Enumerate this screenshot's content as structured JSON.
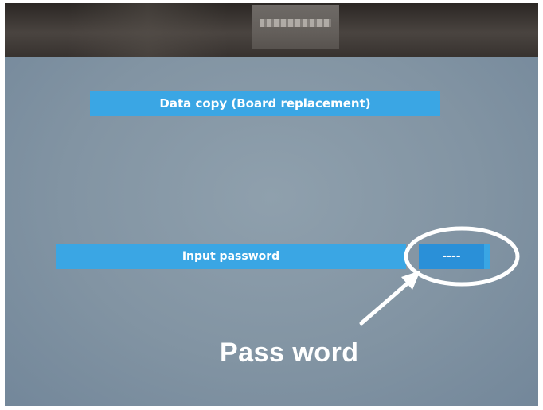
{
  "screen": {
    "title": "Data copy (Board replacement)",
    "password_prompt": "Input password",
    "password_value": "----"
  },
  "annotation": {
    "label": "Pass word",
    "highlight_shape": "ellipse",
    "arrow_icon": "arrow-icon"
  },
  "colors": {
    "menu_bar": "#3aa6e4",
    "screen_background": "#8294a3",
    "annotation": "#ffffff"
  }
}
